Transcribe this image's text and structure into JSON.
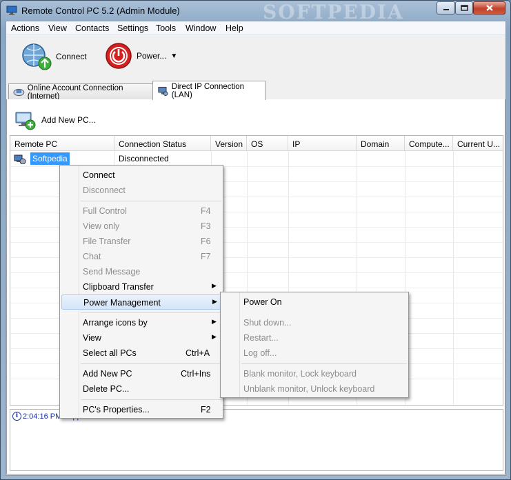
{
  "window": {
    "title": "Remote Control PC 5.2 (Admin Module)",
    "watermark": "SOFTPEDIA"
  },
  "menubar": [
    "Actions",
    "View",
    "Contacts",
    "Settings",
    "Tools",
    "Window",
    "Help"
  ],
  "toolbar": {
    "connect_label": "Connect",
    "power_label": "Power...",
    "power_arrow": "▼"
  },
  "tabs": [
    {
      "label": "Online Account Connection (Internet)",
      "active": false
    },
    {
      "label": "Direct IP Connection (LAN)",
      "active": true
    }
  ],
  "panel": {
    "add_pc_label": "Add New PC..."
  },
  "grid": {
    "columns": [
      "Remote PC",
      "Connection Status",
      "Version",
      "OS",
      "IP",
      "Domain",
      "Compute...",
      "Current U..."
    ],
    "rows": [
      {
        "name": "Softpedia",
        "status": "Disconnected"
      }
    ]
  },
  "log": {
    "time": "2:04:16 PM",
    "message": "> Application has been started"
  },
  "context_menu": {
    "connect": "Connect",
    "disconnect": "Disconnect",
    "full_control": "Full Control",
    "full_control_sc": "F4",
    "view_only": "View only",
    "view_only_sc": "F3",
    "file_transfer": "File Transfer",
    "file_transfer_sc": "F6",
    "chat": "Chat",
    "chat_sc": "F7",
    "send_message": "Send Message",
    "clipboard_transfer": "Clipboard Transfer",
    "power_management": "Power Management",
    "arrange_icons": "Arrange icons by",
    "view": "View",
    "select_all": "Select all PCs",
    "select_all_sc": "Ctrl+A",
    "add_new_pc": "Add New PC",
    "add_new_pc_sc": "Ctrl+Ins",
    "delete_pc": "Delete PC...",
    "properties": "PC's Properties...",
    "properties_sc": "F2",
    "submenu_arrow": "▶"
  },
  "power_submenu": {
    "power_on": "Power On",
    "shut_down": "Shut down...",
    "restart": "Restart...",
    "log_off": "Log off...",
    "blank_monitor": "Blank monitor, Lock keyboard",
    "unblank_monitor": "Unblank monitor, Unlock keyboard"
  },
  "colors": {
    "selection": "#3399ff",
    "log_text": "#1a2e9c",
    "power_red": "#d42020"
  }
}
